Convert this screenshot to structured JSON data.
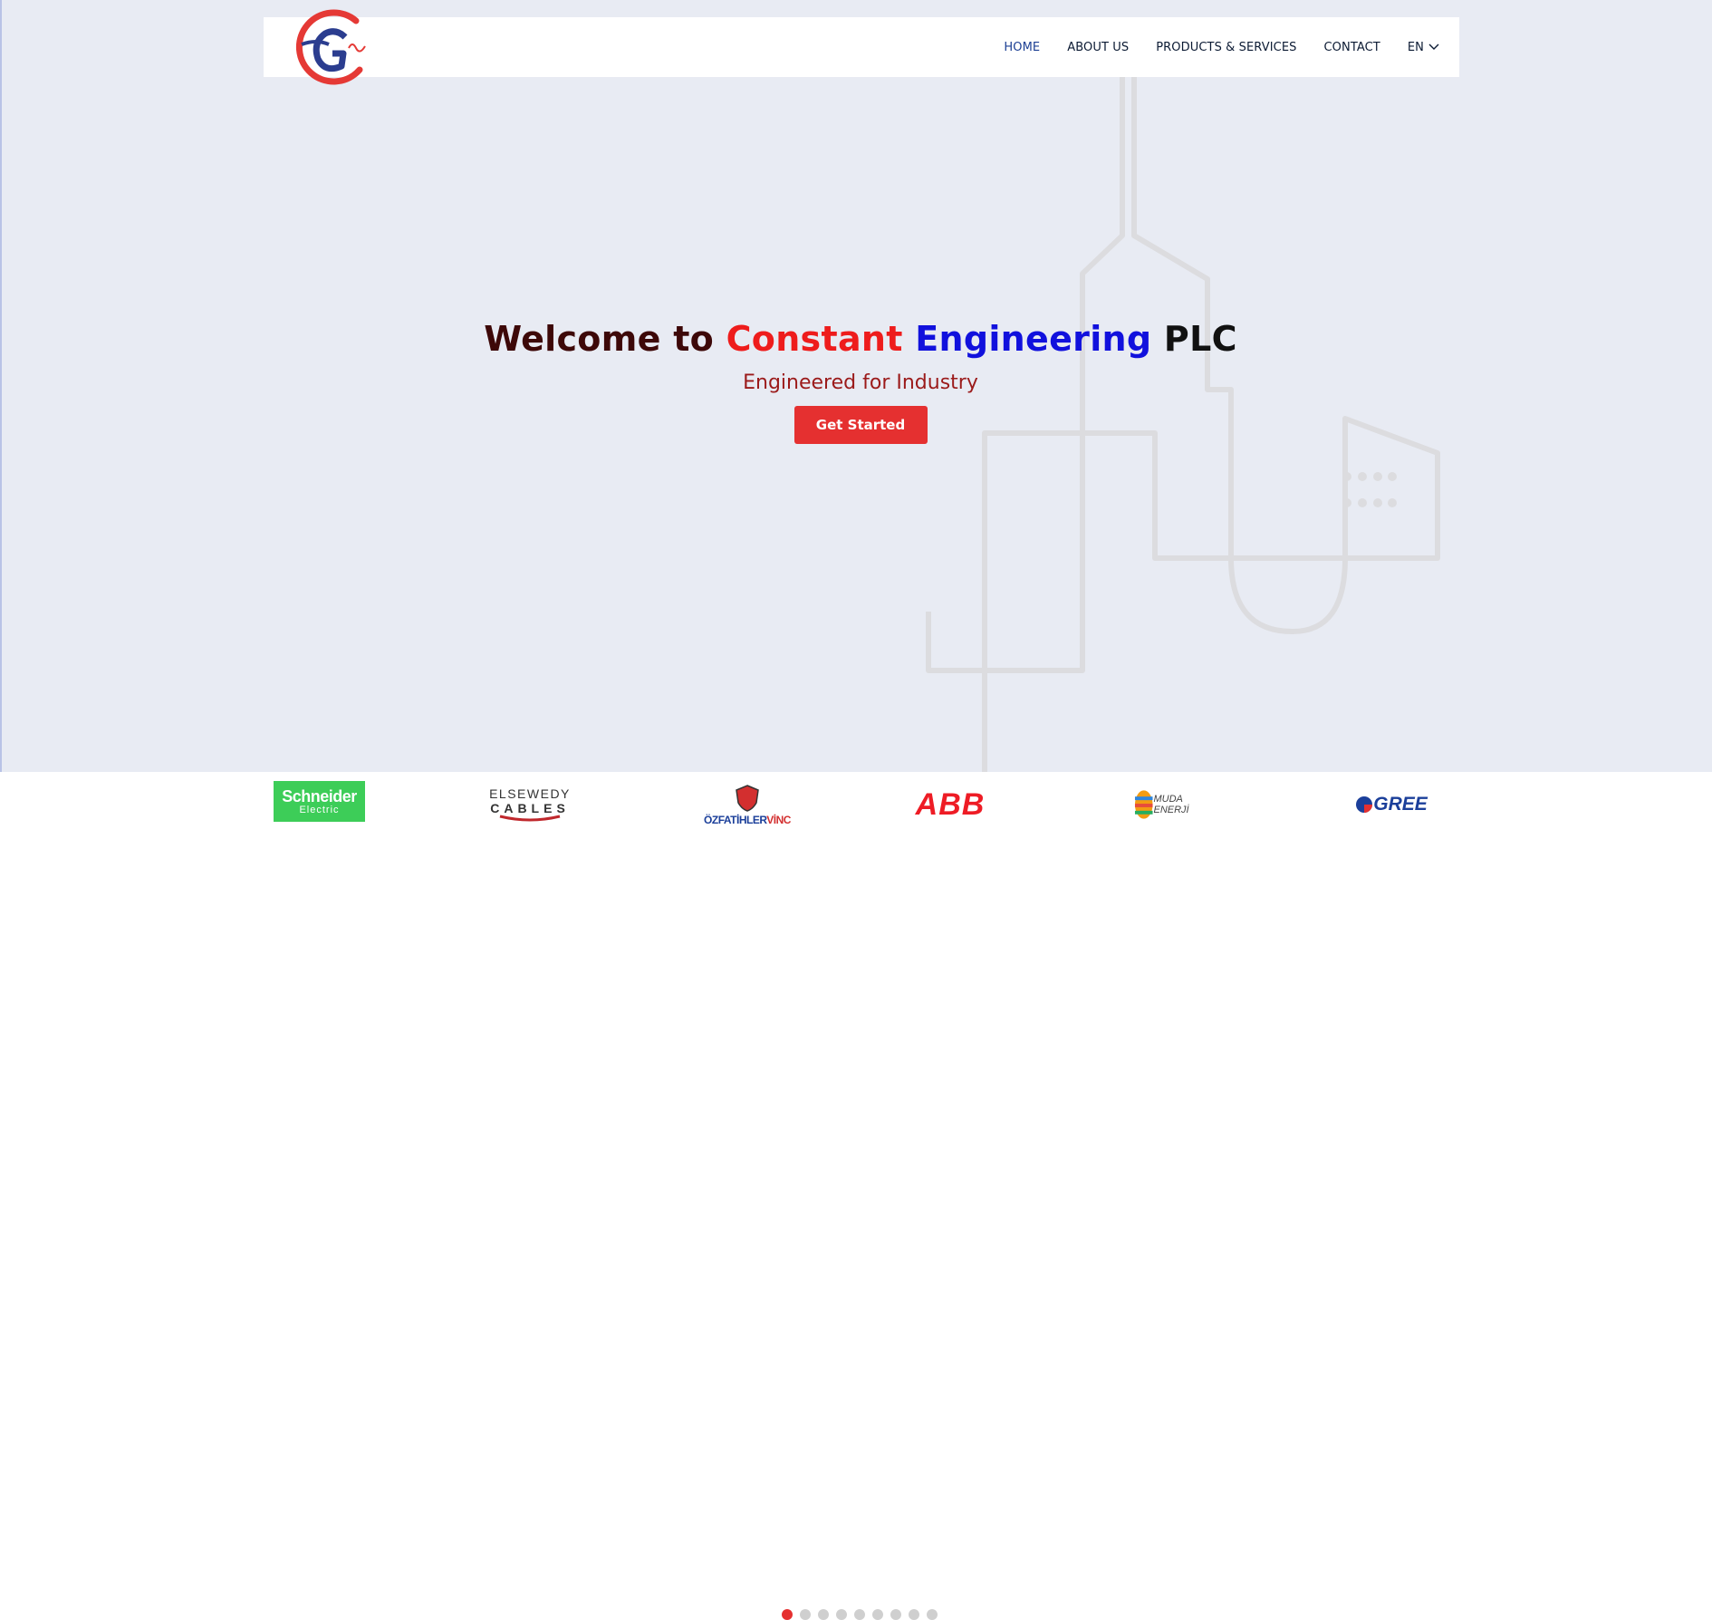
{
  "nav": {
    "items": [
      {
        "label": "HOME",
        "active": true
      },
      {
        "label": "ABOUT US",
        "active": false
      },
      {
        "label": "PRODUCTS & SERVICES",
        "active": false
      },
      {
        "label": "CONTACT",
        "active": false
      }
    ],
    "language": "EN"
  },
  "hero": {
    "title_part1": "Welcome to ",
    "title_part2": "Constant ",
    "title_part3": "Engineering ",
    "title_part4": "PLC",
    "subtitle": "Engineered for Industry",
    "cta_label": "Get Started"
  },
  "brands": {
    "schneider_line1": "Schneider",
    "schneider_line2": "Electric",
    "elsewedy_line1": "ELSEWEDY",
    "elsewedy_line2": "CABLES",
    "ozf_part1": "ÖZFATİHLER",
    "ozf_part2": "VİNC",
    "abb": "ABB",
    "muda": "MUDA ENERJİ",
    "gree": "GREE"
  },
  "carousel": {
    "total": 9,
    "active_index": 0
  },
  "colors": {
    "accent_red": "#e53030",
    "nav_active": "#1c3f94",
    "title_dark": "#3d0808",
    "title_red": "#ee1c1c",
    "title_blue": "#1111dd",
    "hero_bg": "#e8ebf3"
  },
  "icons": [
    "company-logo",
    "chevron-down-icon"
  ]
}
